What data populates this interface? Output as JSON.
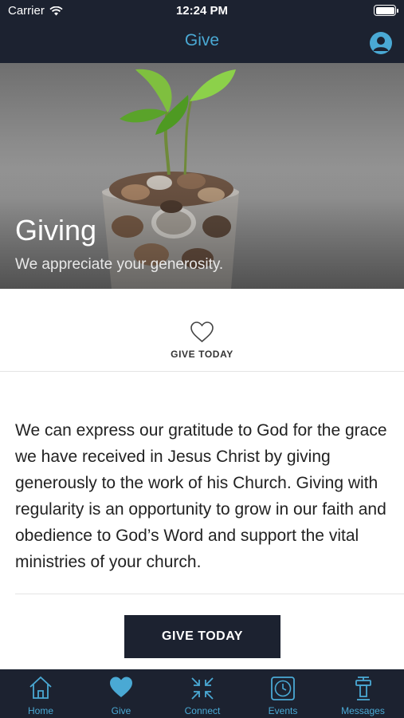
{
  "status_bar": {
    "carrier": "Carrier",
    "time": "12:24 PM"
  },
  "nav": {
    "title": "Give",
    "profile_icon": "user-circle-icon"
  },
  "hero": {
    "title": "Giving",
    "subtitle": "We appreciate your generosity."
  },
  "give_section": {
    "icon": "heart-outline-icon",
    "label": "GIVE TODAY"
  },
  "body": {
    "paragraph": "We can express our gratitude to God for the grace we have received in Jesus Christ by giving generously to the work of his Church. Giving with regularity is an opportunity to grow in our faith and obedience to God’s Word and support the vital ministries of your church."
  },
  "cta": {
    "label": "GIVE TODAY"
  },
  "tabbar": {
    "items": [
      {
        "label": "Home",
        "icon": "home-icon"
      },
      {
        "label": "Give",
        "icon": "heart-icon"
      },
      {
        "label": "Connect",
        "icon": "connect-arrows-icon"
      },
      {
        "label": "Events",
        "icon": "clock-icon"
      },
      {
        "label": "Messages",
        "icon": "podium-icon"
      }
    ]
  },
  "colors": {
    "dark": "#1c2230",
    "accent": "#4aa9d4"
  }
}
